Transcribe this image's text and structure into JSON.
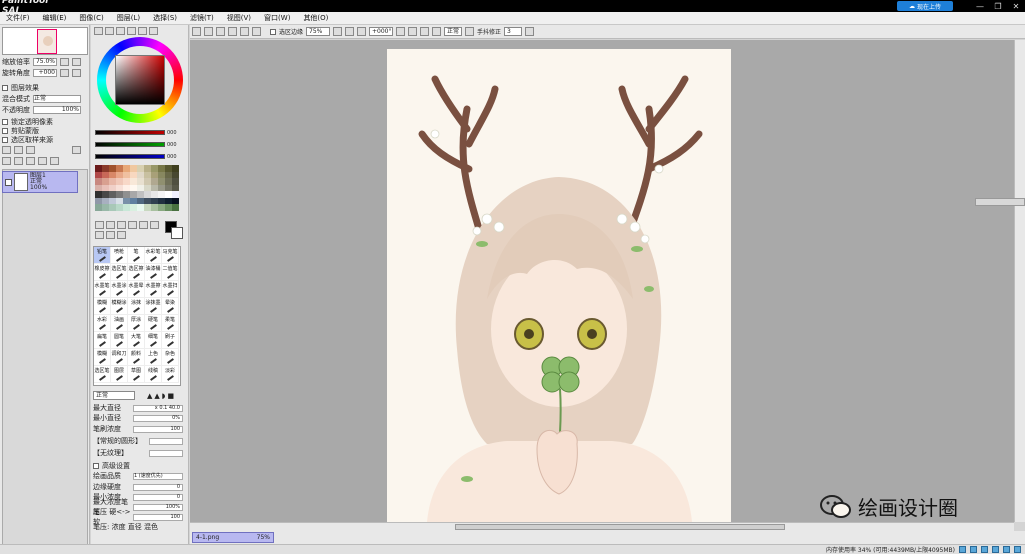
{
  "app": {
    "title": "PaintTool SAI",
    "cloud_button": "现在上传",
    "window_buttons": [
      "—",
      "❐",
      "✕"
    ]
  },
  "menu": {
    "items": [
      "文件(F)",
      "编辑(E)",
      "图像(C)",
      "图层(L)",
      "选择(S)",
      "滤镜(T)",
      "视图(V)",
      "窗口(W)",
      "其他(O)"
    ]
  },
  "navigator": {
    "zoom_label": "缩放倍率",
    "zoom_value": "75.0%",
    "angle_label": "旋转角度",
    "angle_value": "+000"
  },
  "layer_panel": {
    "section": "图层效果",
    "blend_label": "混合模式",
    "blend_value": "正常",
    "opacity_label": "不透明度",
    "opacity_value": "100%",
    "options": [
      "锁定透明像素",
      "剪贴蒙版",
      "选区取样来源"
    ],
    "layer_name": "图层1",
    "layer_sub": "正常",
    "layer_sub2": "100%"
  },
  "color": {
    "slider_values": [
      "000",
      "000",
      "000"
    ],
    "slider_colors": [
      "#c00000",
      "#00a000",
      "#0000c8"
    ]
  },
  "swatches": [
    "#6b1b1b",
    "#8a3a2a",
    "#a0522d",
    "#c87850",
    "#e8a878",
    "#f0c8a0",
    "#d8d0b0",
    "#b8b088",
    "#989868",
    "#787848",
    "#585830",
    "#404020",
    "#b04848",
    "#c86858",
    "#d88868",
    "#e8a888",
    "#f0c0a0",
    "#f8d8c0",
    "#e0d8c8",
    "#c8c0a0",
    "#a8a078",
    "#888860",
    "#686848",
    "#484830",
    "#c88880",
    "#d8a090",
    "#e8b8a8",
    "#f0c8b8",
    "#f8d8c8",
    "#f8e8d8",
    "#e8e0d0",
    "#d0c8b0",
    "#b0a890",
    "#909070",
    "#707058",
    "#505040",
    "#d8b0a8",
    "#e8c0b8",
    "#f0d0c8",
    "#f8e0d8",
    "#fff0e8",
    "#fff8f0",
    "#f0f0e8",
    "#d8d8c8",
    "#b8b8a8",
    "#989888",
    "#787868",
    "#585848",
    "#303030",
    "#484848",
    "#606060",
    "#787878",
    "#909090",
    "#a8a8a8",
    "#c0c0c0",
    "#d8d8d8",
    "#e8e8e8",
    "#f4f4f4",
    "#ffffff",
    "#f0f0ff",
    "#9098a8",
    "#a8b0c0",
    "#c0c8d8",
    "#d8e0e8",
    "#7890a8",
    "#6080a0",
    "#506880",
    "#405060",
    "#304050",
    "#203040",
    "#102030",
    "#081020",
    "#88a898",
    "#98b8a8",
    "#a8c8b8",
    "#b8d8c8",
    "#c8e8d8",
    "#d8f0e0",
    "#e8f8f0",
    "#c8d8c0",
    "#a8c0a0",
    "#88a880",
    "#689060",
    "#487040"
  ],
  "tools": [
    "铅笔",
    "喷枪",
    "笔",
    "水彩笔",
    "马克笔",
    "橡皮擦",
    "选区笔",
    "选区擦",
    "油漆桶",
    "二值笔",
    "水墨笔",
    "水墨涂",
    "水墨晕",
    "水墨擦",
    "水墨扫",
    "模糊",
    "模糊涂",
    "涂抹",
    "涂抹墨",
    "晕染",
    "水彩",
    "油画",
    "厚涂",
    "硬笔",
    "柔笔",
    "扁笔",
    "圆笔",
    "大笔",
    "细笔",
    "刷子",
    "模糊",
    "调和刀",
    "颜料",
    "上色",
    "杂色",
    "选区笔",
    "图层",
    "草图",
    "线稿",
    "淡彩"
  ],
  "brush_params": {
    "mode": "正常",
    "size_label": "最大直径",
    "size_value": "x 0.1   40.0",
    "min_size_label": "最小直径",
    "min_size_value": "0%",
    "density_label": "笔刷浓度",
    "density_value": "100",
    "shape_label": "【常规的圆形】",
    "texture_label": "【无纹理】",
    "advanced_label": "高级设置",
    "quality_label": "绘画品质",
    "quality_value": "1 (速度优先)",
    "edge_label": "边缘硬度",
    "edge_value": "0",
    "min_density_label": "最小浓度",
    "min_density_value": "0",
    "max_pressure_label": "最大浓度笔压",
    "max_pressure_value": "100%",
    "pressure_label": "笔压 硬<->软",
    "pressure_value": "100",
    "checks": "笔压: 浓度  直径  混色"
  },
  "toolbar": {
    "antialias_label": "选区边缘",
    "zoom_value": "75%",
    "rotate_value": "+000°",
    "mode_value": "正常",
    "stabilizer_label": "手抖修正",
    "stabilizer_value": "3"
  },
  "document": {
    "tab_name": "4-1.png",
    "tab_zoom": "75%"
  },
  "status": {
    "memory": "内存使用率  34% (可用:4439MB/上限4095MB)"
  },
  "watermark": {
    "text": "绘画设计圈"
  }
}
